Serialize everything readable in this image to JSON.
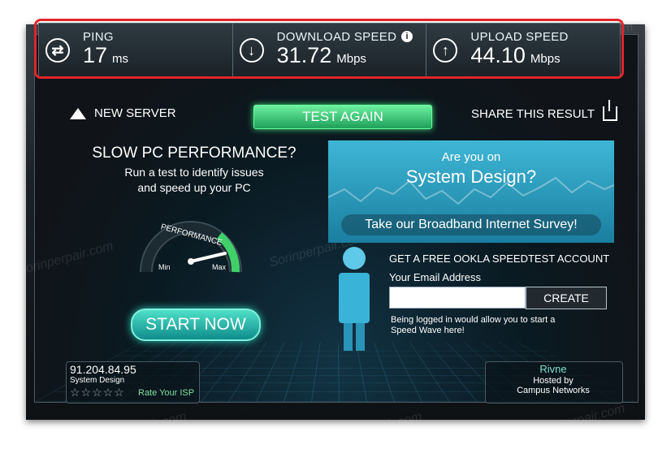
{
  "stats": {
    "ping": {
      "label": "PING",
      "value": "17",
      "unit": "ms"
    },
    "download": {
      "label": "DOWNLOAD SPEED",
      "value": "31.72",
      "unit": "Mbps"
    },
    "upload": {
      "label": "UPLOAD SPEED",
      "value": "44.10",
      "unit": "Mbps"
    }
  },
  "actions": {
    "new_server": "NEW SERVER",
    "test_again": "TEST AGAIN",
    "share": "SHARE THIS RESULT"
  },
  "ad": {
    "title": "SLOW PC PERFORMANCE?",
    "subtitle_line1": "Run a test to identify issues",
    "subtitle_line2": "and speed up your PC",
    "gauge_label": "PERFORMANCE",
    "gauge_min": "Min",
    "gauge_max": "Max",
    "start_button": "START NOW"
  },
  "survey": {
    "line1": "Are you on",
    "line2": "System Design?",
    "button": "Take our Broadband Internet Survey!"
  },
  "account": {
    "title": "GET A FREE OOKLA SPEEDTEST ACCOUNT",
    "email_label": "Your Email Address",
    "email_value": "",
    "create_button": "CREATE",
    "note": "Being logged in would allow you to start a Speed Wave here!"
  },
  "isp": {
    "ip": "91.204.84.95",
    "name": "System Design",
    "rate_label": "Rate Your ISP",
    "stars": "☆☆☆☆☆"
  },
  "host": {
    "city": "Rivne",
    "hosted_by": "Hosted by",
    "network": "Campus Networks"
  },
  "watermark": "Sorinperpair.com",
  "colors": {
    "accent_green": "#1ea05a",
    "highlight_red": "#e0252a",
    "survey_blue": "#2a9abd"
  }
}
